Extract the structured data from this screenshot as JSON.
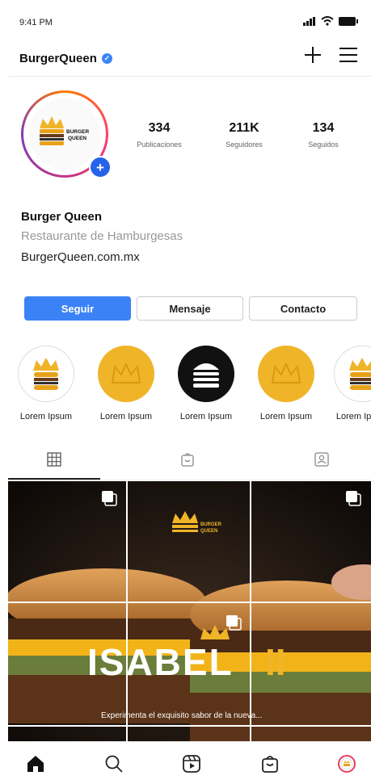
{
  "status_bar": {
    "time": "9:41 PM"
  },
  "header": {
    "username": "BurgerQueen"
  },
  "profile": {
    "logo_text_line1": "BURGER",
    "logo_text_line2": "QUEEN",
    "stats": [
      {
        "value": "334",
        "label": "Publicaciones"
      },
      {
        "value": "211K",
        "label": "Seguidores"
      },
      {
        "value": "134",
        "label": "Seguidos"
      }
    ],
    "name": "Burger Queen",
    "category": "Restaurante de Hamburgesas",
    "website": "BurgerQueen.com.mx"
  },
  "actions": {
    "follow": "Seguir",
    "message": "Mensaje",
    "contact": "Contacto"
  },
  "highlights": [
    {
      "label": "Lorem Ipsum",
      "icon": "crown-burger-icon"
    },
    {
      "label": "Lorem Ipsum",
      "icon": "crown-icon"
    },
    {
      "label": "Lorem Ipsum",
      "icon": "burger-icon"
    },
    {
      "label": "Lorem Ipsum",
      "icon": "crown-icon"
    },
    {
      "label": "Lorem Ipsum",
      "icon": "crown-burger-icon"
    }
  ],
  "post": {
    "brand_line1": "BURGER",
    "brand_line2": "QUEEN",
    "headline_a": "ISABEL",
    "headline_b": "II",
    "tagline": "Experimenta el exquisito sabor de la nueva..."
  },
  "colors": {
    "accent": "#3b82f6",
    "gold": "#f0b429",
    "dark": "#111111"
  }
}
